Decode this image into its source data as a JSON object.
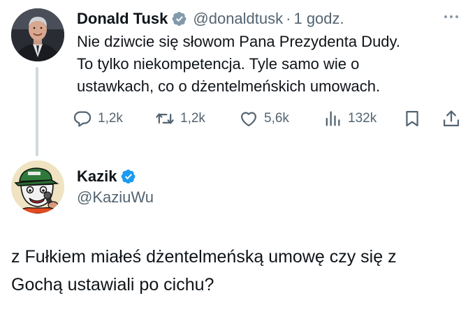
{
  "tweet": {
    "author_name": "Donald Tusk",
    "handle": "@donaldtusk",
    "separator": "·",
    "time": "1 godz.",
    "text_lines": [
      "Nie dziwcie się słowom Pana Prezydenta Dudy.",
      "To tylko niekompetencja. Tyle samo wie o",
      "ustawkach, co o dżentelmeńskich umowach."
    ],
    "actions": {
      "replies": "1,2k",
      "retweets": "1,2k",
      "likes": "5,6k",
      "views": "132k"
    },
    "icons": {
      "verified": "verified-badge-gray",
      "more": "more-horizontal-icon",
      "reply": "reply-icon",
      "retweet": "retweet-icon",
      "like": "heart-icon",
      "views": "views-chart-icon",
      "bookmark": "bookmark-icon",
      "share": "share-icon"
    }
  },
  "reply": {
    "author_name": "Kazik",
    "handle": "@KaziuWu",
    "text_lines": [
      "z Fułkiem miałeś dżentelmeńską umowę czy się z",
      "Gochą ustawiali po cichu?"
    ],
    "icons": {
      "verified": "verified-badge-blue"
    }
  },
  "colors": {
    "text": "#0f1419",
    "secondary": "#536471",
    "verified_gray": "#829aab",
    "verified_blue": "#1d9bf0",
    "thread_line": "#cfd9de"
  }
}
